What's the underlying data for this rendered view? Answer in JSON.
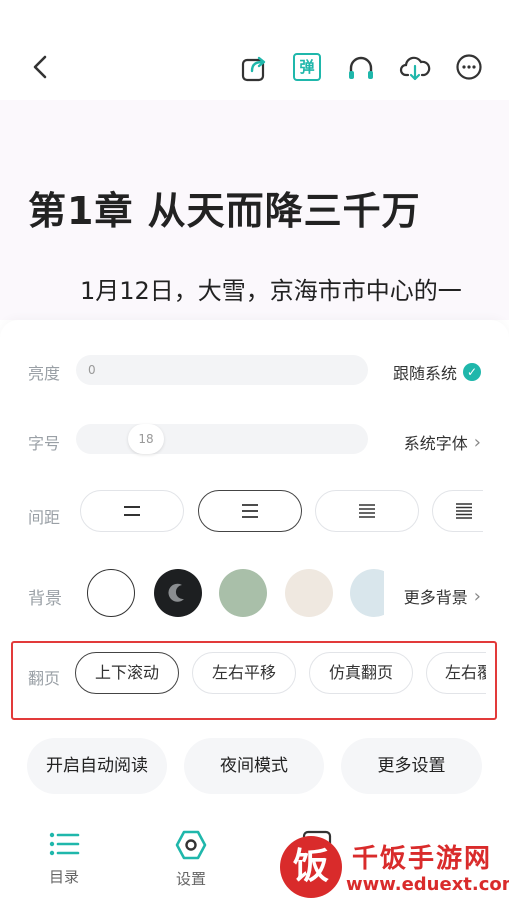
{
  "topbar": {
    "back_icon": "chevron-left-icon",
    "icons": [
      "share-icon",
      "danmu-icon",
      "headphones-icon",
      "cloud-download-icon",
      "more-icon"
    ],
    "danmu_label": "弹"
  },
  "reader": {
    "chapter_title": "第1章 从天而降三千万",
    "paragraph": "1月12日，大雪，京海市市中心的一"
  },
  "settings": {
    "brightness": {
      "label": "亮度",
      "value": "0",
      "follow_system_label": "跟随系统",
      "follow_system_checked": true
    },
    "font_size": {
      "label": "字号",
      "value": "18",
      "font_link": "系统字体"
    },
    "spacing": {
      "label": "间距",
      "options": [
        "compact",
        "normal",
        "loose",
        "extra-loose"
      ],
      "selected_index": 1
    },
    "background": {
      "label": "背景",
      "swatches": [
        "#ffffff",
        "#1d1f21",
        "#a9bfa9",
        "#efe8e0",
        "#d9e6ec"
      ],
      "more_label": "更多背景"
    },
    "page_turn": {
      "label": "翻页",
      "options": [
        "上下滚动",
        "左右平移",
        "仿真翻页",
        "左右覆盖"
      ],
      "selected_index": 0
    }
  },
  "actions": [
    "开启自动阅读",
    "夜间模式",
    "更多设置"
  ],
  "bottom_nav": [
    {
      "label": "目录",
      "icon": "list-icon"
    },
    {
      "label": "设置",
      "icon": "settings-icon"
    }
  ],
  "watermark": {
    "logo_char": "饭",
    "title": "千饭手游网",
    "url": "www.eduext.com"
  },
  "colors": {
    "accent": "#1fb7ab",
    "highlight_box": "#e23a3a",
    "watermark": "#d92b2b"
  }
}
